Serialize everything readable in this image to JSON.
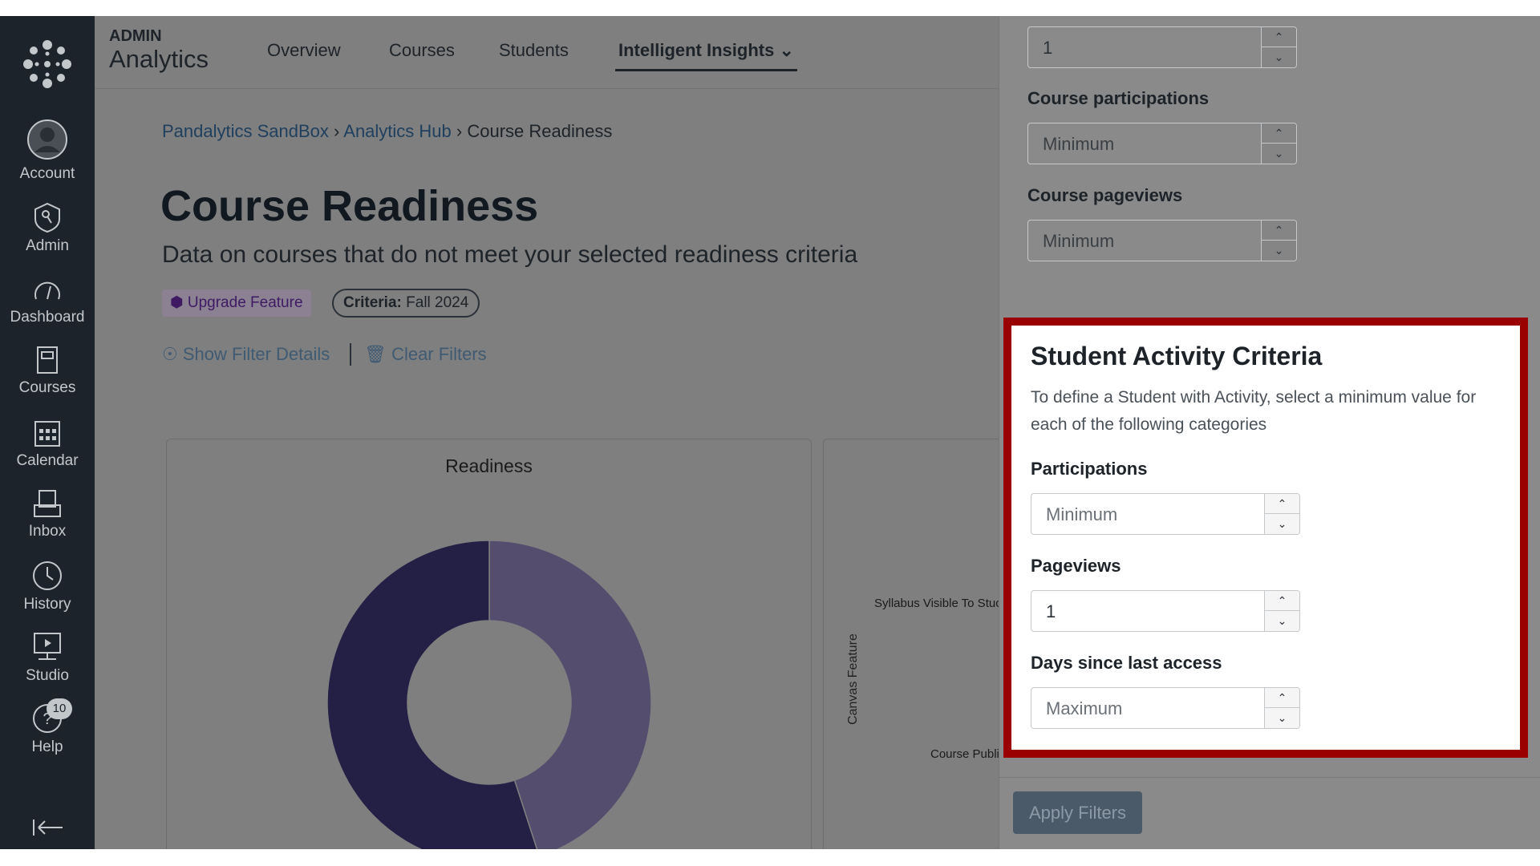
{
  "sidebar": {
    "items": [
      {
        "label": "Account",
        "icon": "avatar-icon"
      },
      {
        "label": "Admin",
        "icon": "shield-icon"
      },
      {
        "label": "Dashboard",
        "icon": "gauge-icon"
      },
      {
        "label": "Courses",
        "icon": "book-icon"
      },
      {
        "label": "Calendar",
        "icon": "calendar-icon"
      },
      {
        "label": "Inbox",
        "icon": "inbox-icon"
      },
      {
        "label": "History",
        "icon": "clock-icon"
      },
      {
        "label": "Studio",
        "icon": "studio-icon"
      },
      {
        "label": "Help",
        "icon": "help-icon",
        "badge": "10"
      }
    ]
  },
  "header": {
    "eyebrow": "ADMIN",
    "app": "Analytics",
    "tabs": [
      "Overview",
      "Courses",
      "Students",
      "Intelligent Insights"
    ],
    "active_tab": "Intelligent Insights"
  },
  "breadcrumb": [
    "Pandalytics SandBox",
    "Analytics Hub",
    "Course Readiness"
  ],
  "page": {
    "title": "Course Readiness",
    "subtitle": "Data on courses that do not meet your selected readiness criteria",
    "badge_upgrade": "Upgrade Feature",
    "criteria_label": "Criteria:",
    "criteria_value": "Fall 2024",
    "show_filter": "Show Filter Details",
    "clear_filters": "Clear Filters"
  },
  "chart_data": [
    {
      "type": "pie",
      "title": "Readiness",
      "values": [
        55,
        45
      ],
      "colors": [
        "#231f45",
        "#544d6e"
      ],
      "donut": true
    },
    {
      "type": "bar",
      "ylabel": "Canvas Feature",
      "categories": [
        "Syllabus Visible To Stuc",
        "Course Publi"
      ]
    }
  ],
  "panel": {
    "top_value": "1",
    "fields_top": [
      {
        "label": "Course participations",
        "placeholder": "Minimum"
      },
      {
        "label": "Course pageviews",
        "placeholder": "Minimum"
      }
    ],
    "section": {
      "title": "Student Activity Criteria",
      "desc1": "To define a Student with Activity, select a minimum value for",
      "desc2": "each of the following categories",
      "fields": [
        {
          "label": "Participations",
          "placeholder": "Minimum",
          "value": ""
        },
        {
          "label": "Pageviews",
          "placeholder": "",
          "value": "1"
        },
        {
          "label": "Days since last access",
          "placeholder": "Maximum",
          "value": ""
        }
      ]
    },
    "apply": "Apply Filters"
  },
  "colors": {
    "highlight": "#9b0000",
    "sidebar": "#1d232a"
  }
}
